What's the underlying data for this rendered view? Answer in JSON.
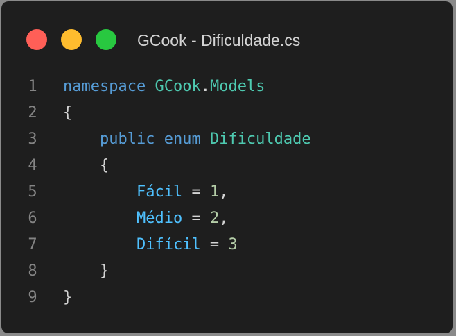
{
  "window": {
    "title": "GCook - Dificuldade.cs",
    "buttons": [
      {
        "name": "close",
        "color": "#ff5f57"
      },
      {
        "name": "minimize",
        "color": "#febc2e"
      },
      {
        "name": "zoom",
        "color": "#28c840"
      }
    ]
  },
  "colors": {
    "background": "#1e1e1e",
    "keyword": "#569cd6",
    "type": "#4ec9b0",
    "plain": "#d4d4d4",
    "enum_member": "#4fc1ff",
    "number": "#b5cea8",
    "line_number": "#858585"
  },
  "code": {
    "lines": [
      {
        "num": "1",
        "indent": "",
        "tokens": [
          {
            "t": "namespace",
            "k": "kw"
          },
          {
            "t": " ",
            "k": "pl"
          },
          {
            "t": "GCook",
            "k": "ty"
          },
          {
            "t": ".",
            "k": "pl"
          },
          {
            "t": "Models",
            "k": "ty"
          }
        ]
      },
      {
        "num": "2",
        "indent": "",
        "tokens": [
          {
            "t": "{",
            "k": "pl"
          }
        ]
      },
      {
        "num": "3",
        "indent": "    ",
        "tokens": [
          {
            "t": "public",
            "k": "kw"
          },
          {
            "t": " ",
            "k": "pl"
          },
          {
            "t": "enum",
            "k": "kw"
          },
          {
            "t": " ",
            "k": "pl"
          },
          {
            "t": "Dificuldade",
            "k": "ty"
          }
        ]
      },
      {
        "num": "4",
        "indent": "    ",
        "tokens": [
          {
            "t": "{",
            "k": "pl"
          }
        ]
      },
      {
        "num": "5",
        "indent": "        ",
        "tokens": [
          {
            "t": "Fácil",
            "k": "en"
          },
          {
            "t": " = ",
            "k": "pl"
          },
          {
            "t": "1",
            "k": "nm"
          },
          {
            "t": ",",
            "k": "pl"
          }
        ]
      },
      {
        "num": "6",
        "indent": "        ",
        "tokens": [
          {
            "t": "Médio",
            "k": "en"
          },
          {
            "t": " = ",
            "k": "pl"
          },
          {
            "t": "2",
            "k": "nm"
          },
          {
            "t": ",",
            "k": "pl"
          }
        ]
      },
      {
        "num": "7",
        "indent": "        ",
        "tokens": [
          {
            "t": "Difícil",
            "k": "en"
          },
          {
            "t": " = ",
            "k": "pl"
          },
          {
            "t": "3",
            "k": "nm"
          }
        ]
      },
      {
        "num": "8",
        "indent": "    ",
        "tokens": [
          {
            "t": "}",
            "k": "pl"
          }
        ]
      },
      {
        "num": "9",
        "indent": "",
        "tokens": [
          {
            "t": "}",
            "k": "pl"
          }
        ]
      }
    ]
  }
}
